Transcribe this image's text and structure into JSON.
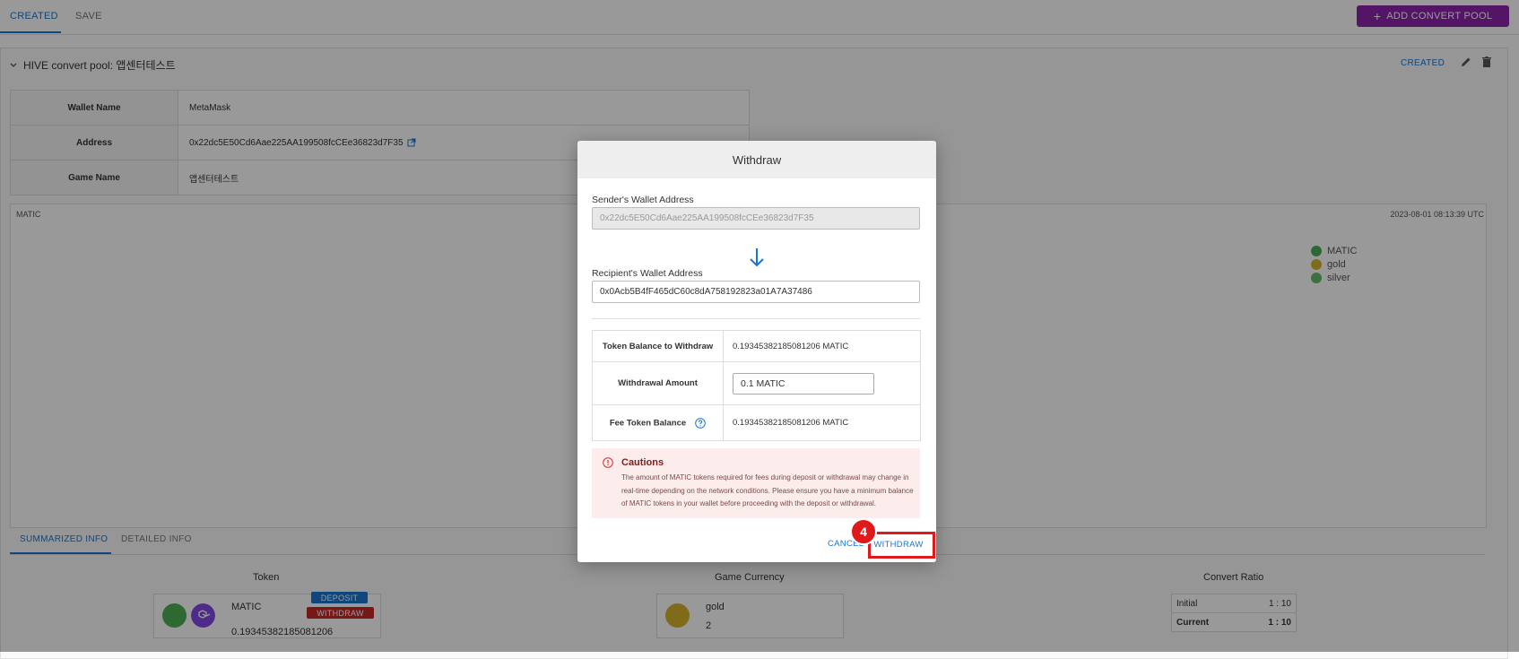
{
  "top_tabs": {
    "created": "CREATED",
    "save": "SAVE"
  },
  "add_pool_button": {
    "icon": "plus-icon",
    "label": "ADD CONVERT POOL"
  },
  "pool": {
    "title": "HIVE convert pool: 앱센터테스트",
    "status": "CREATED",
    "info": [
      {
        "key": "Wallet Name",
        "value": "MetaMask"
      },
      {
        "key": "Address",
        "value": "0x22dc5E50Cd6Aae225AA199508fcCEe36823d7F35"
      },
      {
        "key": "Game Name",
        "value": "앱센터테스트"
      }
    ]
  },
  "chart": {
    "token_label": "MATIC",
    "timestamp": "2023-08-01 08:13:39 UTC",
    "legend": [
      {
        "name": "MATIC",
        "color": "#4caf50"
      },
      {
        "name": "gold",
        "color": "#d4b32c"
      },
      {
        "name": "silver",
        "color": "#66bb6a"
      }
    ]
  },
  "sub_tabs": {
    "summarized": "SUMMARIZED INFO",
    "detailed": "DETAILED INFO"
  },
  "summary": {
    "token": {
      "title": "Token",
      "name": "MATIC",
      "balance": "0.19345382185081206",
      "deposit_label": "DEPOSIT",
      "withdraw_label": "WITHDRAW",
      "colors": {
        "green": "#4caf50",
        "purple": "#8247e5"
      }
    },
    "game_currency": {
      "title": "Game Currency",
      "name": "gold",
      "amount": "2",
      "color": "#d4b32c"
    },
    "convert_ratio": {
      "title": "Convert Ratio",
      "rows": [
        {
          "label": "Initial",
          "value": "1 : 10"
        },
        {
          "label": "Current",
          "value": "1 : 10"
        }
      ]
    }
  },
  "modal": {
    "title": "Withdraw",
    "sender_label": "Sender's Wallet Address",
    "sender_value": "0x22dc5E50Cd6Aae225AA199508fcCEe36823d7F35",
    "recipient_label": "Recipient's Wallet Address",
    "recipient_value": "0x0Acb5B4fF465dC60c8dA758192823a01A7A37486",
    "rows": {
      "balance_label": "Token Balance to Withdraw",
      "balance_value": "0.19345382185081206 MATIC",
      "amount_label": "Withdrawal Amount",
      "amount_value": "0.1 MATIC",
      "fee_label": "Fee Token Balance",
      "fee_value": "0.19345382185081206 MATIC"
    },
    "cautions_title": "Cautions",
    "cautions_text": "The amount of MATIC tokens required for fees during deposit or withdrawal may change in real-time depending on the network conditions. Please ensure you have a minimum balance of MATIC tokens in your wallet before proceeding with the deposit or withdrawal.",
    "cancel_label": "CANCEL",
    "withdraw_label": "WITHDRAW"
  },
  "annotation": {
    "step": "4",
    "color": "#e0191a"
  }
}
